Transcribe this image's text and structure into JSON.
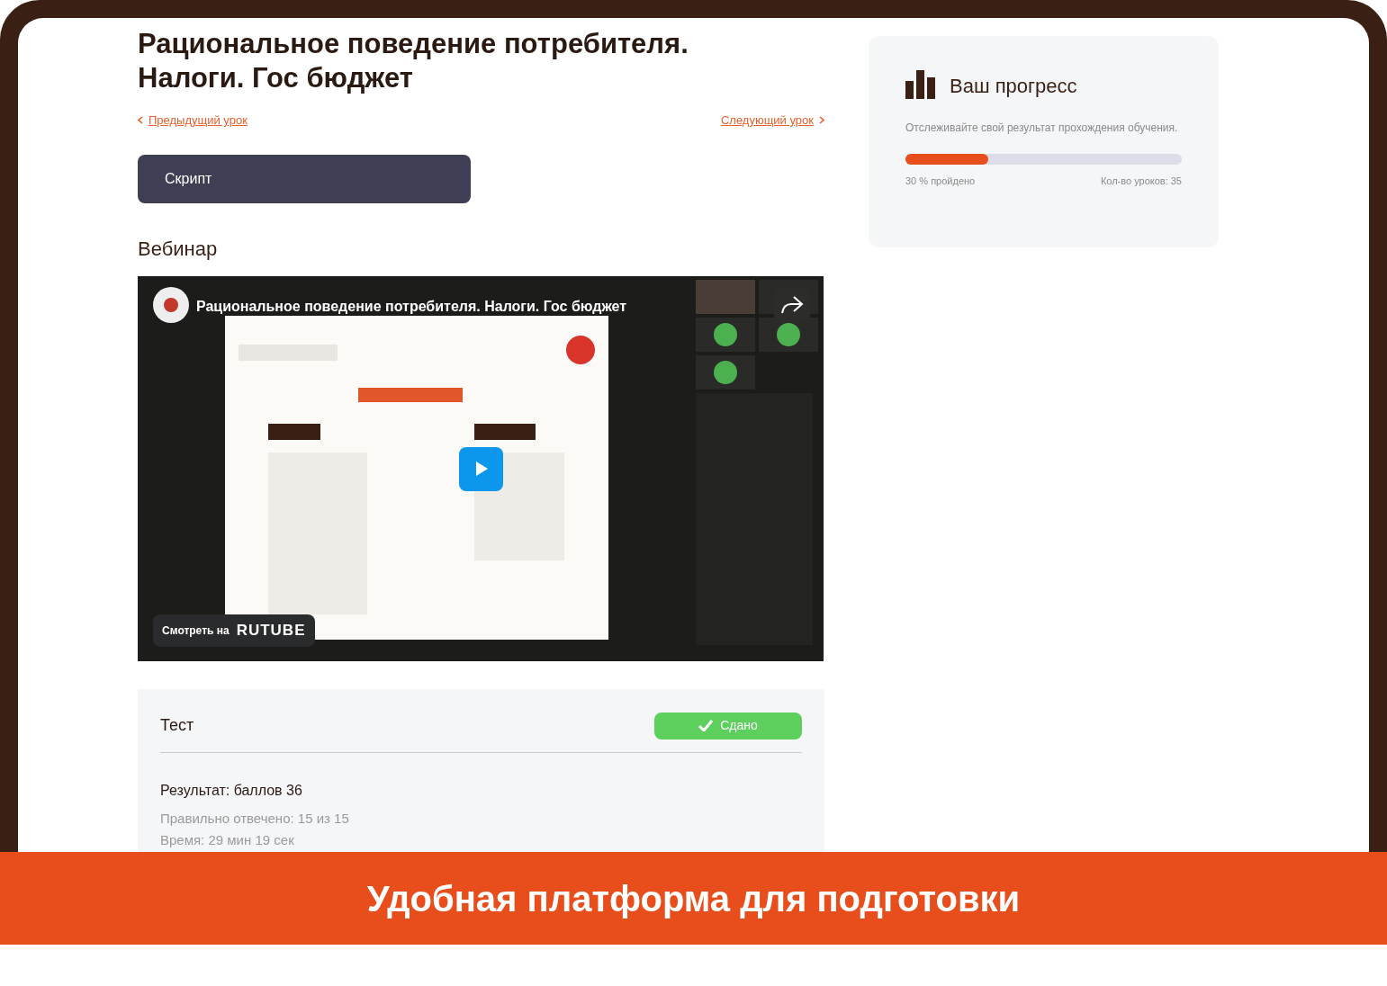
{
  "lesson": {
    "title": "Рациональное поведение потребителя. Налоги. Гос бюджет",
    "prev_link": "Предыдущий урок",
    "next_link": "Следующий урок",
    "script_button": "Скрипт",
    "webinar_heading": "Вебинар"
  },
  "video": {
    "kind": "picture",
    "title": "Рациональное поведение потребителя. Налоги. Гос бюджет",
    "watch_label": "Смотреть на",
    "watch_brand": "RUTUBE"
  },
  "test": {
    "title": "Тест",
    "status": "Сдано",
    "passed": true,
    "result": "Результат: баллов 36",
    "correct": "Правильно отвечено: 15 из 15",
    "time": "Время: 29 мин 19 сек"
  },
  "progress": {
    "title": "Ваш прогресс",
    "description": "Отслеживайте свой результат прохождения обучения.",
    "level": 0.3,
    "done_label": "30 % пройдено",
    "lessons_label": "Кол-во уроков: 35"
  },
  "banner": {
    "text": "Удобная платформа для подготовки"
  }
}
